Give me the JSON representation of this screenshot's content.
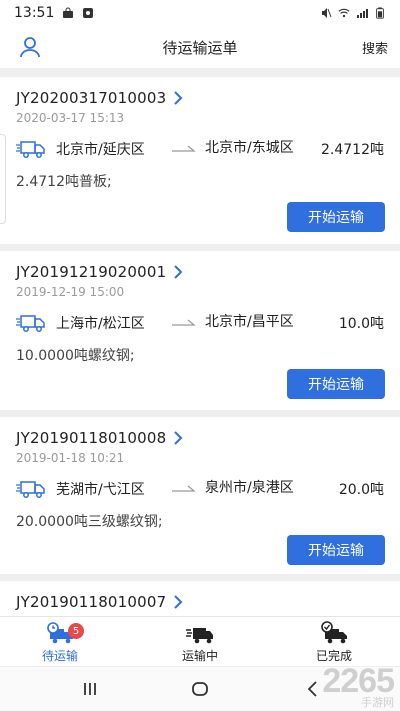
{
  "status_bar": {
    "time": "13:51"
  },
  "header": {
    "title": "待运输运单",
    "search_label": "搜索"
  },
  "orders": [
    {
      "id": "JY20200317010003",
      "time": "2020-03-17 15:13",
      "from": "北京市/延庆区",
      "to": "北京市/东城区",
      "weight": "2.4712吨",
      "goods": "2.4712吨普板;",
      "action": "开始运输"
    },
    {
      "id": "JY20191219020001",
      "time": "2019-12-19 15:00",
      "from": "上海市/松江区",
      "to": "北京市/昌平区",
      "weight": "10.0吨",
      "goods": "10.0000吨螺纹钢;",
      "action": "开始运输"
    },
    {
      "id": "JY20190118010008",
      "time": "2019-01-18 10:21",
      "from": "芜湖市/弋江区",
      "to": "泉州市/泉港区",
      "weight": "20.0吨",
      "goods": "20.0000吨三级螺纹钢;",
      "action": "开始运输"
    },
    {
      "id": "JY20190118010007"
    }
  ],
  "bottom_nav": {
    "items": [
      {
        "label": "待运输",
        "badge": "5",
        "active": true
      },
      {
        "label": "运输中"
      },
      {
        "label": "已完成"
      }
    ]
  },
  "watermark": {
    "main": "2265",
    "sub": "手游网"
  },
  "colors": {
    "accent": "#2f6fde",
    "badge": "#e84a4a",
    "muted": "#9a9a9a"
  }
}
